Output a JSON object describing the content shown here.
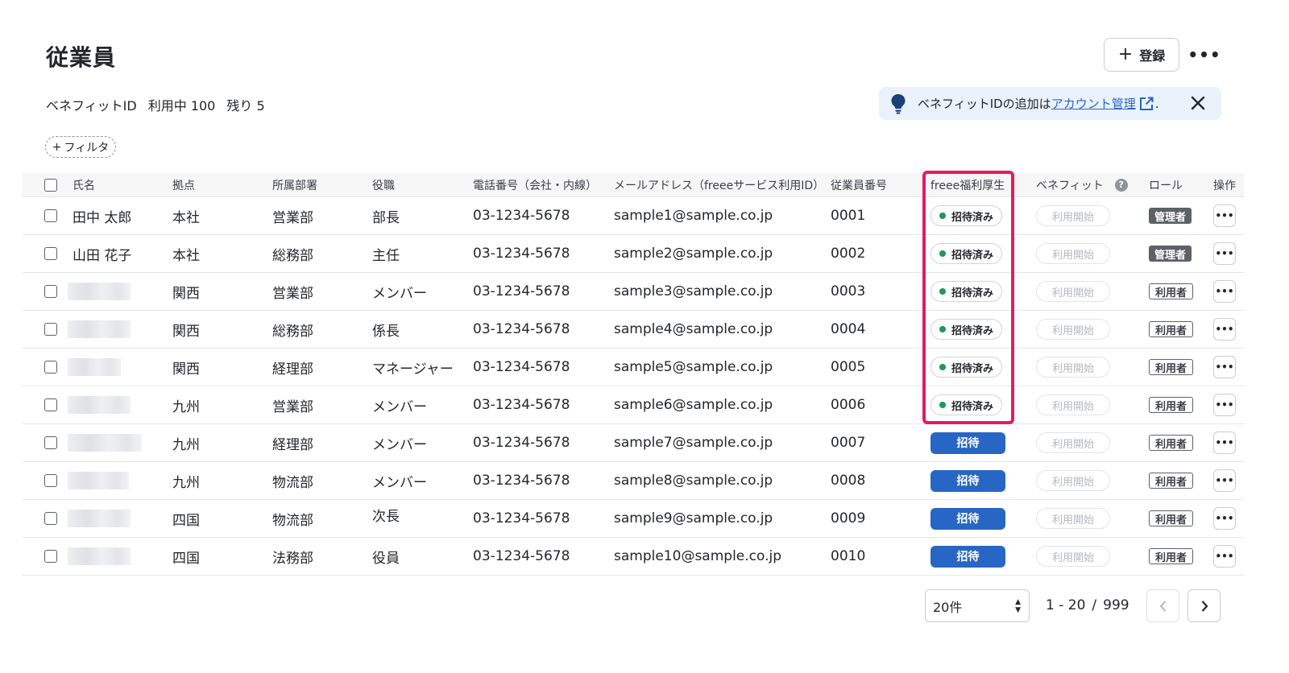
{
  "header": {
    "title": "従業員",
    "register_label": "登録",
    "more_label": "•••"
  },
  "usage": {
    "label": "ベネフィットID",
    "in_use": "利用中 100",
    "remaining": "残り 5"
  },
  "notice": {
    "text_before": "ベネフィットIDの追加は",
    "link": "アカウント管理",
    "text_after": "."
  },
  "filter": {
    "label": "フィルタ",
    "plus": "+"
  },
  "table": {
    "headers": {
      "name": "氏名",
      "location": "拠点",
      "department": "所属部署",
      "position": "役職",
      "phone": "電話番号（会社・内線）",
      "email": "メールアドレス（freeeサービス利用ID）",
      "employee_no": "従業員番号",
      "welfare": "freee福利厚生",
      "benefit": "ベネフィット",
      "role": "ロール",
      "actions": "操作"
    },
    "rows": [
      {
        "name": "田中 太郎",
        "name_visible": true,
        "location": "本社",
        "department": "営業部",
        "position": "部長",
        "phone": "03-1234-5678",
        "email": "sample1@sample.co.jp",
        "employee_no": "0001",
        "welfare": "招待済み",
        "welfare_state": "invited",
        "benefit": "利用開始",
        "role": "管理者",
        "role_type": "admin"
      },
      {
        "name": "山田 花子",
        "name_visible": true,
        "location": "本社",
        "department": "総務部",
        "position": "主任",
        "phone": "03-1234-5678",
        "email": "sample2@sample.co.jp",
        "employee_no": "0002",
        "welfare": "招待済み",
        "welfare_state": "invited",
        "benefit": "利用開始",
        "role": "管理者",
        "role_type": "admin"
      },
      {
        "name": "",
        "name_visible": false,
        "location": "関西",
        "department": "営業部",
        "position": "メンバー",
        "phone": "03-1234-5678",
        "email": "sample3@sample.co.jp",
        "employee_no": "0003",
        "welfare": "招待済み",
        "welfare_state": "invited",
        "benefit": "利用開始",
        "role": "利用者",
        "role_type": "user"
      },
      {
        "name": "",
        "name_visible": false,
        "location": "関西",
        "department": "総務部",
        "position": "係長",
        "phone": "03-1234-5678",
        "email": "sample4@sample.co.jp",
        "employee_no": "0004",
        "welfare": "招待済み",
        "welfare_state": "invited",
        "benefit": "利用開始",
        "role": "利用者",
        "role_type": "user"
      },
      {
        "name": "",
        "name_visible": false,
        "location": "関西",
        "department": "経理部",
        "position": "マネージャー",
        "phone": "03-1234-5678",
        "email": "sample5@sample.co.jp",
        "employee_no": "0005",
        "welfare": "招待済み",
        "welfare_state": "invited",
        "benefit": "利用開始",
        "role": "利用者",
        "role_type": "user"
      },
      {
        "name": "",
        "name_visible": false,
        "location": "九州",
        "department": "営業部",
        "position": "メンバー",
        "phone": "03-1234-5678",
        "email": "sample6@sample.co.jp",
        "employee_no": "0006",
        "welfare": "招待済み",
        "welfare_state": "invited",
        "benefit": "利用開始",
        "role": "利用者",
        "role_type": "user"
      },
      {
        "name": "",
        "name_visible": false,
        "location": "九州",
        "department": "経理部",
        "position": "メンバー",
        "phone": "03-1234-5678",
        "email": "sample7@sample.co.jp",
        "employee_no": "0007",
        "welfare": "招待",
        "welfare_state": "invite",
        "benefit": "利用開始",
        "role": "利用者",
        "role_type": "user"
      },
      {
        "name": "",
        "name_visible": false,
        "location": "九州",
        "department": "物流部",
        "position": "メンバー",
        "phone": "03-1234-5678",
        "email": "sample8@sample.co.jp",
        "employee_no": "0008",
        "welfare": "招待",
        "welfare_state": "invite",
        "benefit": "利用開始",
        "role": "利用者",
        "role_type": "user"
      },
      {
        "name": "",
        "name_visible": false,
        "location": "四国",
        "department": "物流部",
        "position": "次長",
        "phone": "03-1234-5678",
        "email": "sample9@sample.co.jp",
        "employee_no": "0009",
        "welfare": "招待",
        "welfare_state": "invite",
        "benefit": "利用開始",
        "role": "利用者",
        "role_type": "user"
      },
      {
        "name": "",
        "name_visible": false,
        "location": "四国",
        "department": "法務部",
        "position": "役員",
        "phone": "03-1234-5678",
        "email": "sample10@sample.co.jp",
        "employee_no": "0010",
        "welfare": "招待",
        "welfare_state": "invite",
        "benefit": "利用開始",
        "role": "利用者",
        "role_type": "user"
      }
    ]
  },
  "pagination": {
    "page_size": "20件",
    "range": "1 - 20",
    "separator": "/",
    "total": "999"
  },
  "colors": {
    "accent": "#2766c4",
    "highlight": "#e8195e",
    "invited_dot": "#1a9a52",
    "notice_bg": "#e9f2fb"
  }
}
